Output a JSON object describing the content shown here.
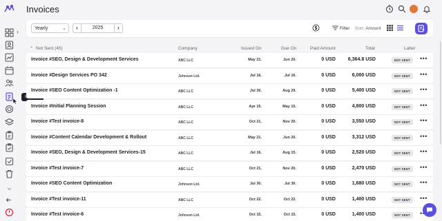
{
  "app": {
    "title": "Invoices",
    "accent_color": "#5b4fe0"
  },
  "sidebar": {
    "tooltip": "Invoices",
    "items": [
      {
        "name": "dashboard-icon"
      },
      {
        "name": "contacts-icon"
      },
      {
        "name": "chart-icon"
      },
      {
        "name": "calendar-icon"
      },
      {
        "name": "people-icon"
      },
      {
        "name": "invoices-icon",
        "active": true
      },
      {
        "name": "target-icon"
      },
      {
        "name": "layers-icon"
      },
      {
        "name": "clipboard-icon"
      },
      {
        "name": "clipboard-check-icon"
      },
      {
        "name": "task-icon"
      },
      {
        "name": "trash-icon"
      }
    ]
  },
  "toolbar": {
    "period": "Yearly",
    "year": "2025",
    "filter_label": "Filter",
    "sort_prefix": "Sort:",
    "sort_value": "Amount"
  },
  "table": {
    "group_label": "Not Sent (45)",
    "columns": {
      "company": "Company",
      "issued": "Issued On",
      "due": "Due On",
      "paid": "Paid Amount",
      "total": "Total",
      "label": "Label"
    },
    "rows": [
      {
        "name": "Invoice #SEO, Design & Development Services",
        "company": "ABC LLC",
        "issued": "May 21.",
        "due": "Jun 20.",
        "paid": "0 USD",
        "total": "6,364.8 USD",
        "label": "NOT SENT"
      },
      {
        "name": "Invoice #Design Services PO 342",
        "company": "Johnson Ltd.",
        "issued": "Jul 16.",
        "due": "Jul 16.",
        "paid": "0 USD",
        "total": "6,000 USD",
        "label": "NOT SENT"
      },
      {
        "name": "Invoice #SEO Content Optimization -1",
        "company": "ABC LLC",
        "issued": "Jul 30.",
        "due": "Aug 29.",
        "paid": "0 USD",
        "total": "5,400 USD",
        "label": "NOT SENT"
      },
      {
        "name": "Invoice #Initial Planning Session",
        "company": "ABC LLC",
        "issued": "Apr 15.",
        "due": "May 15.",
        "paid": "0 USD",
        "total": "4,800 USD",
        "label": "NOT SENT"
      },
      {
        "name": "Invoice #Test invoice-8",
        "company": "ABC LLC",
        "issued": "Oct 21.",
        "due": "Nov 20.",
        "paid": "0 USD",
        "total": "3,550 USD",
        "label": "NOT SENT"
      },
      {
        "name": "Invoice #Content Calendar Development & Rollout",
        "company": "ABC LLC",
        "issued": "May 21.",
        "due": "Jun 20.",
        "paid": "0 USD",
        "total": "3,312 USD",
        "label": "NOT SENT"
      },
      {
        "name": "Invoice #SEO, Design & Development Services-15",
        "company": "ABC LLC",
        "issued": "Jul 16.",
        "due": "Aug 15.",
        "paid": "0 USD",
        "total": "2,520 USD",
        "label": "NOT SENT"
      },
      {
        "name": "Invoice #Test invoice-7",
        "company": "ABC LLC",
        "issued": "Oct 21.",
        "due": "Nov 20.",
        "paid": "0 USD",
        "total": "2,470 USD",
        "label": "NOT SENT"
      },
      {
        "name": "Invoice #SEO Content Optimization",
        "company": "Johnson Ltd.",
        "issued": "Jul 30.",
        "due": "Jul 30.",
        "paid": "0 USD",
        "total": "1,680 USD",
        "label": "NOT SENT"
      },
      {
        "name": "Invoice #Test invoice-11",
        "company": "ABC LLC",
        "issued": "Oct 22.",
        "due": "Oct 22.",
        "paid": "0 USD",
        "total": "1,400 USD",
        "label": "NOT SENT"
      },
      {
        "name": "Invoice #Test invoice-6",
        "company": "Johnson Ltd.",
        "issued": "Oct 15.",
        "due": "Oct 15.",
        "paid": "0 USD",
        "total": "1,400 USD",
        "label": "NOT SENT"
      }
    ]
  }
}
